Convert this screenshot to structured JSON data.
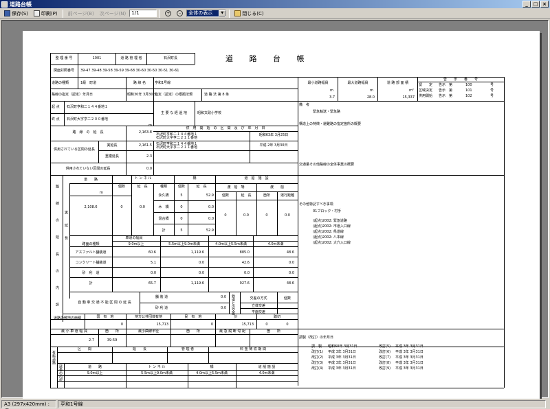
{
  "window": {
    "title": "道路台帳"
  },
  "toolbar": {
    "save_label": "保存(S)",
    "print_label": "印刷(P)",
    "prev_label": "前ページ(B)",
    "next_label": "次ページ(N)",
    "page_value": "1/1",
    "zoom_value": "全体の表示",
    "close_label": "閉じる(C)"
  },
  "status": {
    "paper": "A3 (297x420mm) : 横",
    "route": "亨和1号線"
  },
  "doc": {
    "title": "道 路 台 帳",
    "row1": [
      "整 理 番 号",
      "1001",
      "道 路 管 理 者",
      "石沢町長"
    ],
    "map_no_label": "図面対照番号",
    "map_no": "39-47 39-48 39-58 39-59 39-68 30-60 30-50 30-51 30-61",
    "kind_label": "道路の種類",
    "kind_val": "1級　町道",
    "name_label": "路 線 名",
    "name_val": "亨和1号線",
    "cert_label": "路線の指定（認定）年月日",
    "cert_date": "昭和30年 3月30日",
    "cert_law_label": "指定（認定）の根拠法規",
    "cert_law": "道 路 法 第 8 条",
    "width_min_label": "最小道路幅員",
    "width_max_label": "最大道路幅員",
    "area_label": "道 路 部 面 積",
    "width_min": "3.7",
    "width_max": "28.0",
    "area": "15,337",
    "unit_m": "m",
    "unit_m2": "m²",
    "notice_header": "告　　示　　番　　号",
    "notice": [
      [
        "認　　定",
        "告示　第",
        "100",
        "号"
      ],
      [
        "区域決定",
        "告示　第",
        "101",
        "号"
      ],
      [
        "供用開始",
        "告示　第",
        "102",
        "号"
      ]
    ],
    "start_label": "起 点",
    "start_val": "石沢町亨和二１４４番地１",
    "end_label": "終 点",
    "end_val": "石沢町大字亨二２００番地",
    "via_label": "主 要 な 経 過 地",
    "via_val": "昭和文政小学校",
    "biko_label": "備　考",
    "biko_val": "緊急輸送・緊急路",
    "kyoyo_header": "供　用　開　始　の　区　間　及　び　年　月　日",
    "enchou_label": "路　線　の　延　長",
    "enchou_val": "2,163.8",
    "kyoyo1a": "石沢町亨和二１４４番地１",
    "kyoyo1b": "石沢町大字亨二２１１番地",
    "kyoyo1_date": "昭和63年 3月25日",
    "in_use_label": "供用されている区間の延長",
    "jitsu_label": "実延長",
    "jitsu_val": "2,161.5",
    "jyuufuku_label": "重複延長",
    "jyuufuku_val": "2.3",
    "kyoyo2a": "石沢町亨和二１４４番地１",
    "kyoyo2b": "石沢町大字亨二２１１番地",
    "kyoyo2_date": "平成 2年 3月30日",
    "not_use_label": "供用されていない区間の延長",
    "not_use_val": "0.0",
    "structure_note": "構造上の特徴・避難路の指定箇所の概要",
    "kotsu_note": "交通量その他路線の全体事業の概要",
    "side_label": "路 線 の 延 長 の 内 訳",
    "jitsu_side": "実 延 長",
    "doro_label": "道　　路",
    "tunnel_label": "ト ン ネ ル",
    "bridge_label": "橋",
    "ferry_label": "道　船　施　設",
    "kosu": "個数",
    "encho": "延　長",
    "shurui": "種類",
    "doro_val": "2,108.6",
    "tunnel_count": "0",
    "tunnel_len": "0.0",
    "bridges": [
      [
        "永久橋",
        "5",
        "52.9"
      ],
      [
        "木　橋",
        "0",
        "0.0"
      ],
      [
        "混合橋",
        "0",
        "0.0"
      ],
      [
        "計",
        "5",
        "52.9"
      ]
    ],
    "ferry_sub": [
      "渡　船　場",
      "渡　　船"
    ],
    "ferry_cols": [
      "個数",
      "延　長",
      "箇所",
      "隻数",
      "運行距離"
    ],
    "ferry_vals": [
      "0",
      "0.0",
      "0",
      "0",
      "0.0"
    ],
    "hokan_label": "その他特記すべき事項",
    "hokan_lines": [
      "01ブロック・村手",
      "(起点)2002: 緊急道路",
      "(起点)2002: 市道入口線",
      "(起点)2002: 県道線",
      "(起点)2002: 八本線",
      "(起点)2002: 大穴入口線"
    ],
    "width_header": "車道の幅員",
    "width_cols": [
      "路面の種類",
      "9.0m以上",
      "5.5m以上9.0m未満",
      "4.0m以上5.5m未満",
      "4.0m未満"
    ],
    "surface_rows": [
      [
        "アスファルト舗装道",
        "60.6",
        "1,119.6",
        "885.0",
        "48.6"
      ],
      [
        "コンクリート舗装道",
        "5.1",
        "0.0",
        "42.6",
        "0.0"
      ],
      [
        "砂　利　道",
        "0.0",
        "0.0",
        "0.0",
        "0.0"
      ],
      [
        "計",
        "65.7",
        "1,119.6",
        "927.6",
        "48.6"
      ]
    ],
    "cars_label": "自 動 車 交 通 不 能 区 間 の 延 長",
    "paved_label": "舗 装 道",
    "paved_val": "0.0",
    "gravel_label": "砂 利 道",
    "gravel_val": "0.0",
    "cross_label": "鉄道との交差",
    "cross_type": "交差の方式",
    "cross_count": "個数",
    "cross_a": "立体交差",
    "cross_b": "平面交差",
    "land_label": "道路の敷地の面積",
    "land_cols": [
      "国　有　地",
      "地方公共団体有地",
      "民　有　地",
      "計"
    ],
    "land_vals": [
      "0",
      "15,713",
      "0",
      "15,713"
    ],
    "junction_label": "踏切",
    "junction_vals": [
      "0",
      "0"
    ],
    "bottom_labels": [
      "最 小 車 道 幅 員",
      "箇　　所",
      "最小曲線半径",
      "箇　　所",
      "最 急 縦 断 勾 配",
      "箇　　所"
    ],
    "bottom_vals": [
      "2.7",
      "39-59",
      "",
      "",
      "",
      ""
    ],
    "history_label": "調製（改訂）の年月日",
    "history": [
      [
        "調　製",
        "昭和60年 3月31日"
      ],
      [
        "改訂(1)",
        "平成 3年 3月31日"
      ],
      [
        "改訂(2)",
        "平成 3年 3月31日"
      ],
      [
        "改訂(3)",
        "平成 3年 3月31日"
      ],
      [
        "改訂(4)",
        "平成 3年 3月31日"
      ]
    ],
    "history_r": [
      [
        "改訂(5)",
        "平成 3年 3月31日"
      ],
      [
        "改訂(6)",
        "平成 3年 3月31日"
      ],
      [
        "改訂(7)",
        "平成 3年 3月31日"
      ],
      [
        "改訂(8)",
        "平成 3年 3月31日"
      ],
      [
        "改訂(9)",
        "平成 3年 3月31日"
      ]
    ],
    "toll_labels": [
      "区　　間",
      "延　　長",
      "管 理 者",
      "料 金 徴 収 期 間"
    ],
    "toll_side": "有料道路",
    "breakdown_side": "延長の内訳",
    "breakdown_cols": [
      "道　　路",
      "ト ン ネ ル",
      "橋",
      "道 船 施 設"
    ],
    "breakdown_width": [
      "9.0m以上",
      "5.5m以上9.0m未満",
      "4.0m以上5.5m未満",
      "4.0m未満"
    ]
  }
}
